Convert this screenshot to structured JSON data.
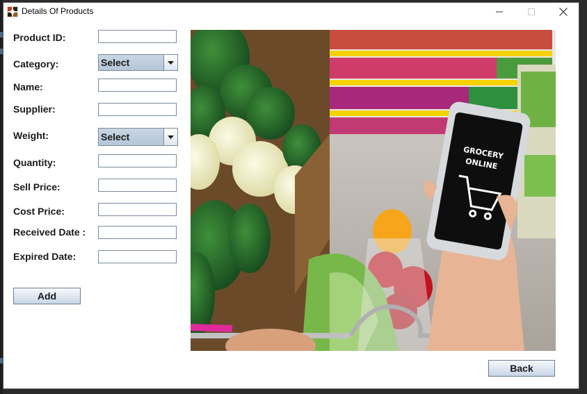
{
  "window": {
    "title": "Details Of Products"
  },
  "icons": {
    "app": "app-icon",
    "minimize": "minimize-icon",
    "maximize": "maximize-icon",
    "close": "close-icon",
    "dropdown": "chevron-down-icon"
  },
  "form": {
    "product_id_label": "Product ID:",
    "category_label": "Category:",
    "category_value": "Select",
    "name_label": "Name:",
    "supplier_label": "Supplier:",
    "weight_label": "Weight:",
    "weight_value": "Select",
    "quantity_label": "Quantity:",
    "sell_price_label": "Sell Price:",
    "cost_price_label": "Cost Price:",
    "received_date_label": "Received Date :",
    "expired_date_label": "Expired Date:",
    "add_label": "Add"
  },
  "image": {
    "phone_text_line1": "GROCERY",
    "phone_text_line2": "ONLINE"
  },
  "footer": {
    "back_label": "Back"
  }
}
